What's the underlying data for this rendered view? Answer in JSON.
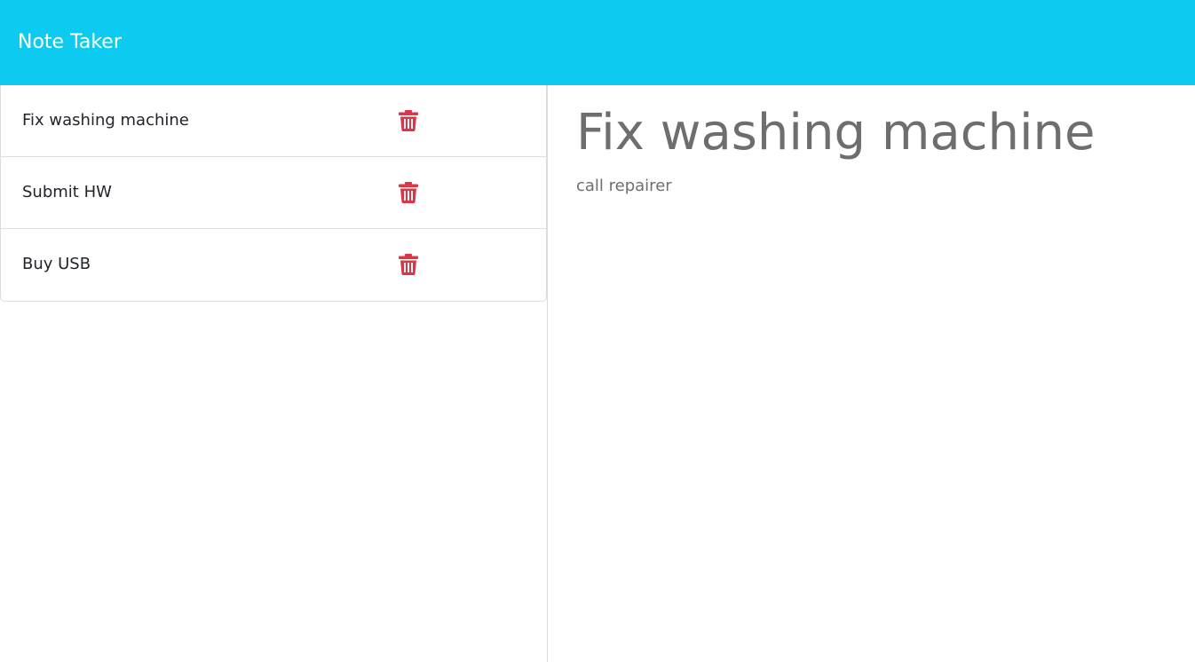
{
  "app": {
    "title": "Note Taker",
    "nav_color": "#0dcaf0",
    "delete_color": "#dc3545"
  },
  "notes": [
    {
      "title": "Fix washing machine",
      "delete_icon": "trash-icon"
    },
    {
      "title": "Submit HW",
      "delete_icon": "trash-icon"
    },
    {
      "title": "Buy USB",
      "delete_icon": "trash-icon"
    }
  ],
  "active_note": {
    "title": "Fix washing machine",
    "text": "call repairer"
  }
}
